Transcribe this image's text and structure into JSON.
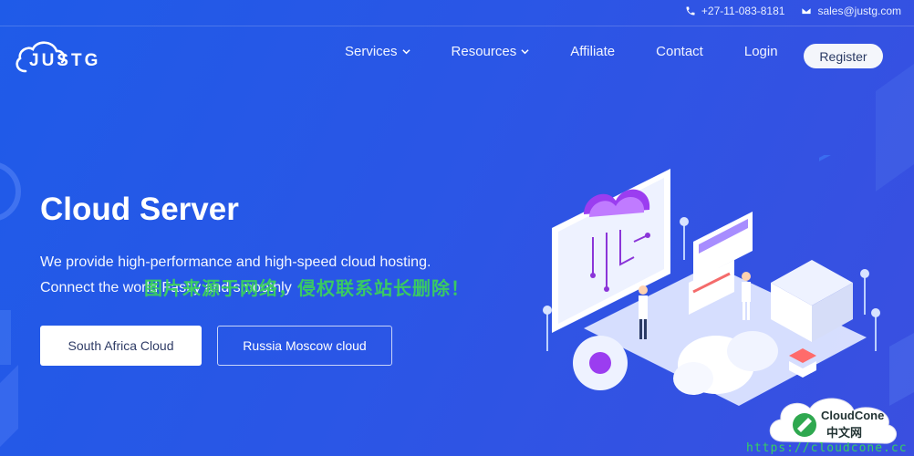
{
  "topbar": {
    "phone": "+27-11-083-8181",
    "email": "sales@justg.com"
  },
  "logo": {
    "text": "JUSTG"
  },
  "nav": {
    "items": [
      {
        "label": "Services",
        "dropdown": true
      },
      {
        "label": "Resources",
        "dropdown": true
      },
      {
        "label": "Affiliate",
        "dropdown": false
      },
      {
        "label": "Contact",
        "dropdown": false
      },
      {
        "label": "Login",
        "dropdown": false
      }
    ],
    "register_label": "Register"
  },
  "hero": {
    "title": "Cloud Server",
    "line1": "We provide high-performance and high-speed cloud hosting.",
    "line2": "Connect the world Fastly and smoothly",
    "primary_button": "South Africa Cloud",
    "secondary_button": "Russia Moscow cloud"
  },
  "watermark": "图片来源于网络，侵权联系站长删除！",
  "badge": {
    "line1": "CloudCone",
    "line2": "中文网",
    "url": "https://cloudcone.cc"
  },
  "colors": {
    "background": "#2a56e6",
    "button_primary_bg": "#ffffff",
    "button_text": "#2f3c66",
    "watermark": "#3bd35a",
    "accent_purple": "#9b3df0"
  }
}
